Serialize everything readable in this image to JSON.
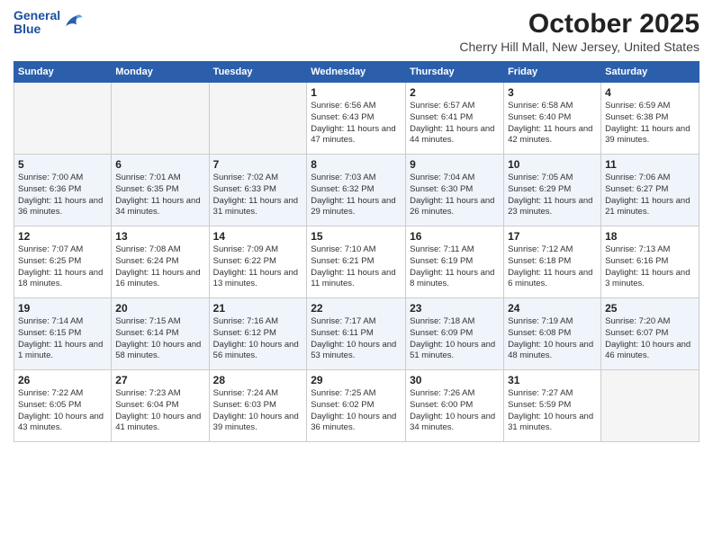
{
  "logo": {
    "line1": "General",
    "line2": "Blue"
  },
  "title": "October 2025",
  "location": "Cherry Hill Mall, New Jersey, United States",
  "days_of_week": [
    "Sunday",
    "Monday",
    "Tuesday",
    "Wednesday",
    "Thursday",
    "Friday",
    "Saturday"
  ],
  "weeks": [
    [
      {
        "day": "",
        "info": ""
      },
      {
        "day": "",
        "info": ""
      },
      {
        "day": "",
        "info": ""
      },
      {
        "day": "1",
        "info": "Sunrise: 6:56 AM\nSunset: 6:43 PM\nDaylight: 11 hours and 47 minutes."
      },
      {
        "day": "2",
        "info": "Sunrise: 6:57 AM\nSunset: 6:41 PM\nDaylight: 11 hours and 44 minutes."
      },
      {
        "day": "3",
        "info": "Sunrise: 6:58 AM\nSunset: 6:40 PM\nDaylight: 11 hours and 42 minutes."
      },
      {
        "day": "4",
        "info": "Sunrise: 6:59 AM\nSunset: 6:38 PM\nDaylight: 11 hours and 39 minutes."
      }
    ],
    [
      {
        "day": "5",
        "info": "Sunrise: 7:00 AM\nSunset: 6:36 PM\nDaylight: 11 hours and 36 minutes."
      },
      {
        "day": "6",
        "info": "Sunrise: 7:01 AM\nSunset: 6:35 PM\nDaylight: 11 hours and 34 minutes."
      },
      {
        "day": "7",
        "info": "Sunrise: 7:02 AM\nSunset: 6:33 PM\nDaylight: 11 hours and 31 minutes."
      },
      {
        "day": "8",
        "info": "Sunrise: 7:03 AM\nSunset: 6:32 PM\nDaylight: 11 hours and 29 minutes."
      },
      {
        "day": "9",
        "info": "Sunrise: 7:04 AM\nSunset: 6:30 PM\nDaylight: 11 hours and 26 minutes."
      },
      {
        "day": "10",
        "info": "Sunrise: 7:05 AM\nSunset: 6:29 PM\nDaylight: 11 hours and 23 minutes."
      },
      {
        "day": "11",
        "info": "Sunrise: 7:06 AM\nSunset: 6:27 PM\nDaylight: 11 hours and 21 minutes."
      }
    ],
    [
      {
        "day": "12",
        "info": "Sunrise: 7:07 AM\nSunset: 6:25 PM\nDaylight: 11 hours and 18 minutes."
      },
      {
        "day": "13",
        "info": "Sunrise: 7:08 AM\nSunset: 6:24 PM\nDaylight: 11 hours and 16 minutes."
      },
      {
        "day": "14",
        "info": "Sunrise: 7:09 AM\nSunset: 6:22 PM\nDaylight: 11 hours and 13 minutes."
      },
      {
        "day": "15",
        "info": "Sunrise: 7:10 AM\nSunset: 6:21 PM\nDaylight: 11 hours and 11 minutes."
      },
      {
        "day": "16",
        "info": "Sunrise: 7:11 AM\nSunset: 6:19 PM\nDaylight: 11 hours and 8 minutes."
      },
      {
        "day": "17",
        "info": "Sunrise: 7:12 AM\nSunset: 6:18 PM\nDaylight: 11 hours and 6 minutes."
      },
      {
        "day": "18",
        "info": "Sunrise: 7:13 AM\nSunset: 6:16 PM\nDaylight: 11 hours and 3 minutes."
      }
    ],
    [
      {
        "day": "19",
        "info": "Sunrise: 7:14 AM\nSunset: 6:15 PM\nDaylight: 11 hours and 1 minute."
      },
      {
        "day": "20",
        "info": "Sunrise: 7:15 AM\nSunset: 6:14 PM\nDaylight: 10 hours and 58 minutes."
      },
      {
        "day": "21",
        "info": "Sunrise: 7:16 AM\nSunset: 6:12 PM\nDaylight: 10 hours and 56 minutes."
      },
      {
        "day": "22",
        "info": "Sunrise: 7:17 AM\nSunset: 6:11 PM\nDaylight: 10 hours and 53 minutes."
      },
      {
        "day": "23",
        "info": "Sunrise: 7:18 AM\nSunset: 6:09 PM\nDaylight: 10 hours and 51 minutes."
      },
      {
        "day": "24",
        "info": "Sunrise: 7:19 AM\nSunset: 6:08 PM\nDaylight: 10 hours and 48 minutes."
      },
      {
        "day": "25",
        "info": "Sunrise: 7:20 AM\nSunset: 6:07 PM\nDaylight: 10 hours and 46 minutes."
      }
    ],
    [
      {
        "day": "26",
        "info": "Sunrise: 7:22 AM\nSunset: 6:05 PM\nDaylight: 10 hours and 43 minutes."
      },
      {
        "day": "27",
        "info": "Sunrise: 7:23 AM\nSunset: 6:04 PM\nDaylight: 10 hours and 41 minutes."
      },
      {
        "day": "28",
        "info": "Sunrise: 7:24 AM\nSunset: 6:03 PM\nDaylight: 10 hours and 39 minutes."
      },
      {
        "day": "29",
        "info": "Sunrise: 7:25 AM\nSunset: 6:02 PM\nDaylight: 10 hours and 36 minutes."
      },
      {
        "day": "30",
        "info": "Sunrise: 7:26 AM\nSunset: 6:00 PM\nDaylight: 10 hours and 34 minutes."
      },
      {
        "day": "31",
        "info": "Sunrise: 7:27 AM\nSunset: 5:59 PM\nDaylight: 10 hours and 31 minutes."
      },
      {
        "day": "",
        "info": ""
      }
    ]
  ]
}
